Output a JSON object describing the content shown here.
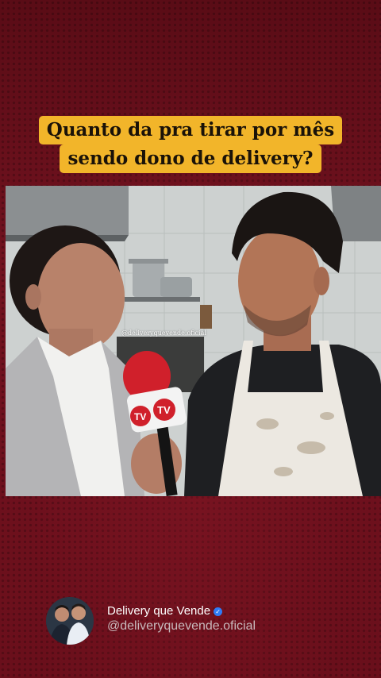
{
  "caption": {
    "line1": "Quanto da pra tirar por mês",
    "line2": "sendo dono de delivery?"
  },
  "video": {
    "watermark": "@deliveryquevende.oficial",
    "mic_brand": "TV"
  },
  "profile": {
    "name": "Delivery que Vende",
    "handle": "@deliveryquevende.oficial",
    "verified_icon": "check-badge-icon"
  },
  "colors": {
    "background": "#6e0f1c",
    "caption_highlight": "#f2b52a",
    "verified": "#2f7cf6"
  }
}
